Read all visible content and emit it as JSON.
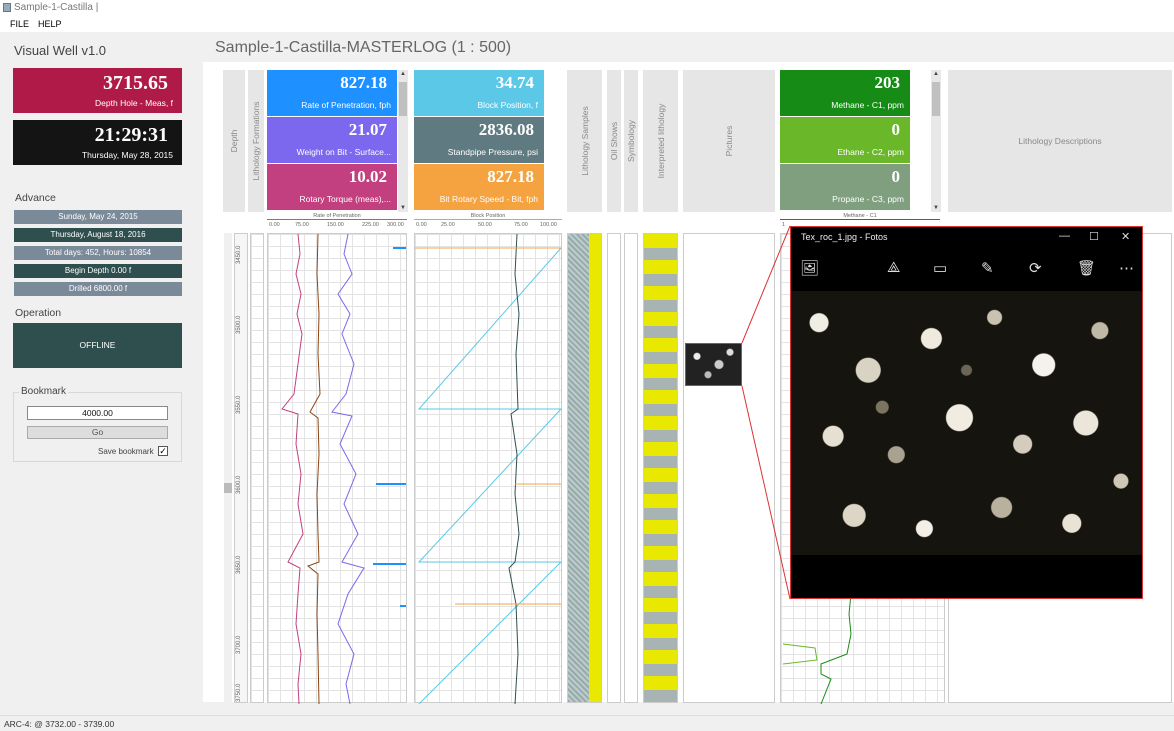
{
  "window": {
    "title": "Sample-1-Castilla |"
  },
  "menu": [
    "FILE",
    "HELP"
  ],
  "sidebar": {
    "app_title": "Visual Well v1.0",
    "depth": {
      "value": "3715.65",
      "label": "Depth Hole - Meas, f"
    },
    "clock": {
      "time": "21:29:31",
      "date": "Thursday, May 28, 2015"
    },
    "advance_title": "Advance",
    "advance_items": [
      "Sunday, May 24, 2015",
      "Thursday, August 18, 2016",
      "Total days: 452, Hours: 10854",
      "Begin Depth 0.00 f",
      "Drilled 6800.00 f"
    ],
    "operation_title": "Operation",
    "operation_status": "OFFLINE",
    "bookmark_title": "Bookmark",
    "bookmark_value": "4000.00",
    "go_label": "Go",
    "save_label": "Save bookmark",
    "save_checked": "✓"
  },
  "main": {
    "log_title": "Sample-1-Castilla-MASTERLOG (1 : 500)",
    "column_labels": {
      "depth": "Depth",
      "lith_formations": "Lithology Formations",
      "lith_samples": "Lithology Samples",
      "oil_shows": "Oil Shows",
      "symbology": "Symbology",
      "interpreted": "Interpreted lithology",
      "pictures": "Pictures",
      "lith_desc": "Lithology Descriptions"
    },
    "cards_group1": [
      {
        "value": "827.18",
        "label": "Rate of Penetration, fph",
        "color": "#1e90ff"
      },
      {
        "value": "21.07",
        "label": "Weight on Bit - Surface...",
        "color": "#7b68ee"
      },
      {
        "value": "10.02",
        "label": "Rotary Torque (meas),...",
        "color": "#c2407f"
      }
    ],
    "cards_group2": [
      {
        "value": "34.74",
        "label": "Block Position, f",
        "color": "#5bc8e8"
      },
      {
        "value": "2836.08",
        "label": "Standpipe Pressure, psi",
        "color": "#5f7a80"
      },
      {
        "value": "827.18",
        "label": "Bit Rotary Speed - Bit, fph",
        "color": "#f4a340"
      }
    ],
    "cards_group3": [
      {
        "value": "203",
        "label": "Methane - C1, ppm",
        "color": "#168c16"
      },
      {
        "value": "0",
        "label": "Ethane - C2, ppm",
        "color": "#6ab82a"
      },
      {
        "value": "0",
        "label": "Propane - C3, ppm",
        "color": "#7f9f7f"
      }
    ],
    "scale_rop": {
      "title": "Rate of Penetration",
      "ticks": [
        "0.00",
        "75.00",
        "150.00",
        "225.00",
        "300.00"
      ]
    },
    "scale_block": {
      "title": "Block Position",
      "ticks": [
        "0.00",
        "25.00",
        "50.00",
        "75.00",
        "100.00"
      ]
    },
    "scale_methane": {
      "title": "Methane - C1",
      "tick": "1"
    },
    "depth_ticks": [
      "3450.0",
      "3500.0",
      "3550.0",
      "3600.0",
      "3650.0",
      "3700.0",
      "3750.0"
    ]
  },
  "photo_viewer": {
    "title": "Tex_roc_1.jpg - Fotos",
    "window_buttons": [
      "—",
      "☐",
      "✕"
    ],
    "tools": [
      "image-icon",
      "share-icon",
      "slideshow-icon",
      "edit-icon",
      "rotate-icon",
      "delete-icon",
      "more-icon"
    ]
  },
  "status": "ARC-4: @ 3732.00 - 3739.00"
}
